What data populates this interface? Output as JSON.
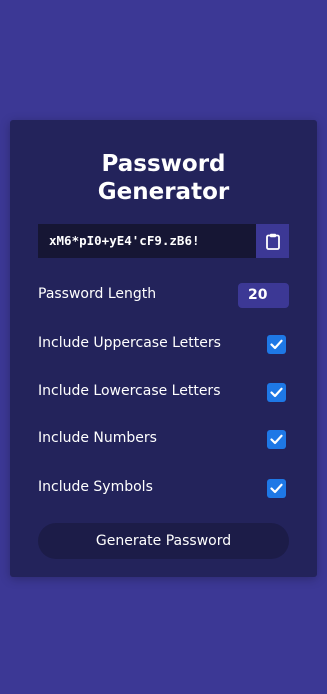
{
  "app": {
    "title_line1": "Password",
    "title_line2": "Generator"
  },
  "result": {
    "password": "xM6*pI0+yE4'cF9.zB6!",
    "copy_icon": "clipboard-icon"
  },
  "settings": {
    "length_label": "Password Length",
    "length_value": "20",
    "options": [
      {
        "label": "Include Uppercase Letters",
        "checked": true
      },
      {
        "label": "Include Lowercase Letters",
        "checked": true
      },
      {
        "label": "Include Numbers",
        "checked": true
      },
      {
        "label": "Include Symbols",
        "checked": true
      }
    ]
  },
  "actions": {
    "generate_label": "Generate Password"
  },
  "colors": {
    "background": "#3c3895",
    "card": "#23235b",
    "result_bg": "#161634",
    "checkbox": "#1e78e6",
    "button": "#1c1c48"
  }
}
